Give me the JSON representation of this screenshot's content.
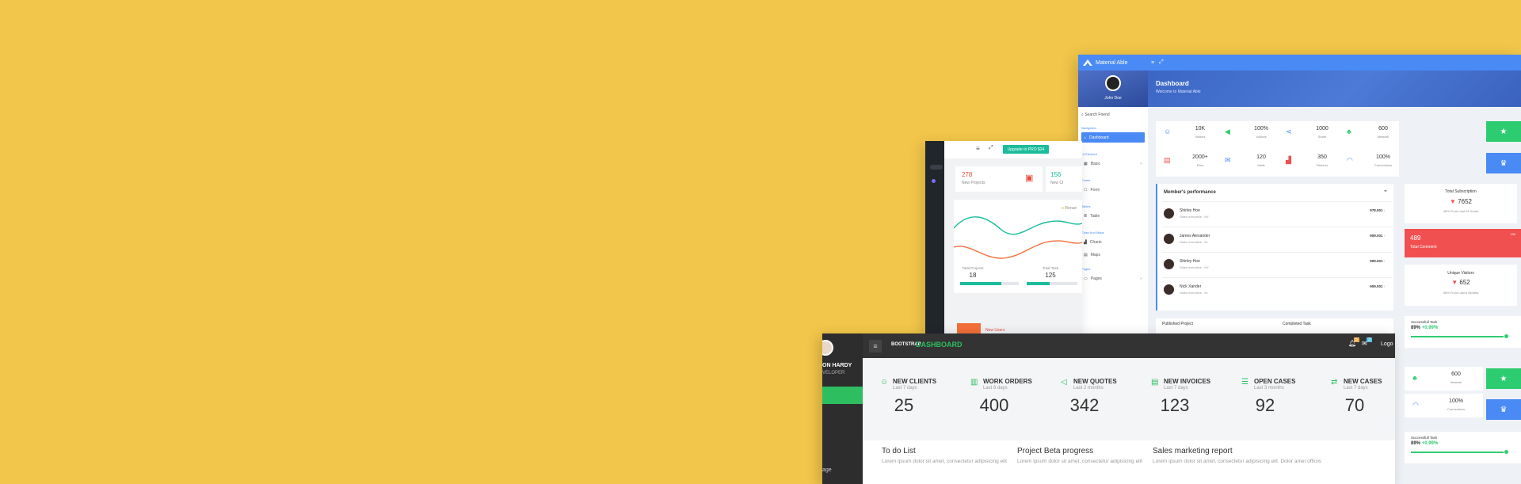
{
  "screen_a": {
    "brand": "Material Able",
    "user": "John Doe",
    "hero_title": "Dashboard",
    "hero_subtitle": "Welcome to Material Able",
    "search_placeholder": "Search Friend",
    "nav": [
      {
        "caption": "Navigation",
        "label": "Dashboard",
        "active": true
      },
      {
        "caption": "UI Element",
        "label": "Basic"
      },
      {
        "caption": "Forms",
        "label": "Form"
      },
      {
        "caption": "Tables",
        "label": "Table"
      },
      {
        "caption": "Chart And Maps",
        "label": "Charts"
      },
      {
        "caption": "",
        "label": "Maps"
      },
      {
        "caption": "Pages",
        "label": "Pages"
      }
    ],
    "stats": [
      {
        "value": "10K",
        "label": "Visitors",
        "icon": "user-icon",
        "color": "#4a8af4"
      },
      {
        "value": "100%",
        "label": "Volume",
        "icon": "volume-icon",
        "color": "#2ecc71"
      },
      {
        "value": "1000",
        "label": "Share",
        "icon": "share-icon",
        "color": "#4a8af4"
      },
      {
        "value": "600",
        "label": "Network",
        "icon": "network-icon",
        "color": "#2ecc71"
      },
      {
        "value": "2000+",
        "label": "Files",
        "icon": "file-icon",
        "color": "#f0504f"
      },
      {
        "value": "120",
        "label": "Mails",
        "icon": "mail-icon",
        "color": "#4a8af4"
      },
      {
        "value": "350",
        "label": "Returns",
        "icon": "signal-icon",
        "color": "#f0504f"
      },
      {
        "value": "100%",
        "label": "Connections",
        "icon": "wifi-icon",
        "color": "#4a8af4"
      }
    ],
    "performance_title": "Member's performance",
    "members": [
      {
        "name": "Shirley Hoe",
        "role": "Sales executive , NY",
        "score": "978.001",
        "trend": "down"
      },
      {
        "name": "James Alexander",
        "role": "Sales executive , EL",
        "score": "909.001",
        "trend": "up"
      },
      {
        "name": "Shirley Hoe",
        "role": "Sales executive , NY",
        "score": "909.001",
        "trend": "up"
      },
      {
        "name": "Nick Xander",
        "role": "Sales executive , EL",
        "score": "909.001",
        "trend": "up"
      }
    ],
    "subscription": {
      "title": "Total Subscription",
      "value": "7652",
      "note": "48% From Last 24 Hours"
    },
    "comment": {
      "value": "489",
      "label": "Total Comment",
      "badge": "10k"
    },
    "visitors": {
      "title": "Unique Visitors",
      "value": "652",
      "note": "36% From Last 6 Months"
    },
    "footer_labels": [
      "Published Project",
      "Completed Task"
    ],
    "task": {
      "title": "Successfull Task",
      "percent": "89%",
      "delta": "+0.99%",
      "progress": 0.89
    },
    "network2": {
      "value": "600",
      "label": "Network"
    },
    "connections2": {
      "value": "100%",
      "label": "Connections"
    },
    "task2": {
      "title": "Successfull Task",
      "percent": "89%",
      "delta": "+0.99%",
      "progress": 0.89
    }
  },
  "screen_b": {
    "upgrade": "Upgrade to PRO $24",
    "kpi1": {
      "value": "278",
      "label": "New Projects"
    },
    "kpi2": {
      "value": "156",
      "label": "New Cl"
    },
    "legend": "Renue",
    "totals": [
      {
        "label": "Total Projects",
        "value": "18"
      },
      {
        "label": "Total Task",
        "value": "125"
      }
    ],
    "new_users": "New Users"
  },
  "screen_c": {
    "user_name": "ON HARDY",
    "user_role": "VELOPER",
    "side_item": "age",
    "logo_small": "BOOTSTRAP",
    "logo_big": "DASHBOARD",
    "logout": "Logo",
    "notif1": "5",
    "notif2": "3",
    "metrics": [
      {
        "title": "NEW CLIENTS",
        "sub": "Last 7 days",
        "value": "25",
        "icon": "user-icon"
      },
      {
        "title": "WORK ORDERS",
        "sub": "Last 6 days",
        "value": "400",
        "icon": "trash-icon"
      },
      {
        "title": "NEW QUOTES",
        "sub": "Last 2 months",
        "value": "342",
        "icon": "megaphone-icon"
      },
      {
        "title": "NEW INVOICES",
        "sub": "Last 7 days",
        "value": "123",
        "icon": "invoice-icon"
      },
      {
        "title": "OPEN CASES",
        "sub": "Last 3 months",
        "value": "92",
        "icon": "list-icon"
      },
      {
        "title": "NEW CASES",
        "sub": "Last 7 days",
        "value": "70",
        "icon": "cases-icon"
      }
    ],
    "panels": [
      {
        "title": "To do List",
        "text": "Lorem ipsum dolor sit amet, consectetur adipisicing elit"
      },
      {
        "title": "Project Beta progress",
        "text": "Lorem ipsum dolor sit amet, consectetur adipisicing elit"
      },
      {
        "title": "Sales marketing report",
        "text": "Lorem ipsum dolor sit amet, consectetur adipisicing elit. Dolor amet officiis"
      }
    ]
  }
}
